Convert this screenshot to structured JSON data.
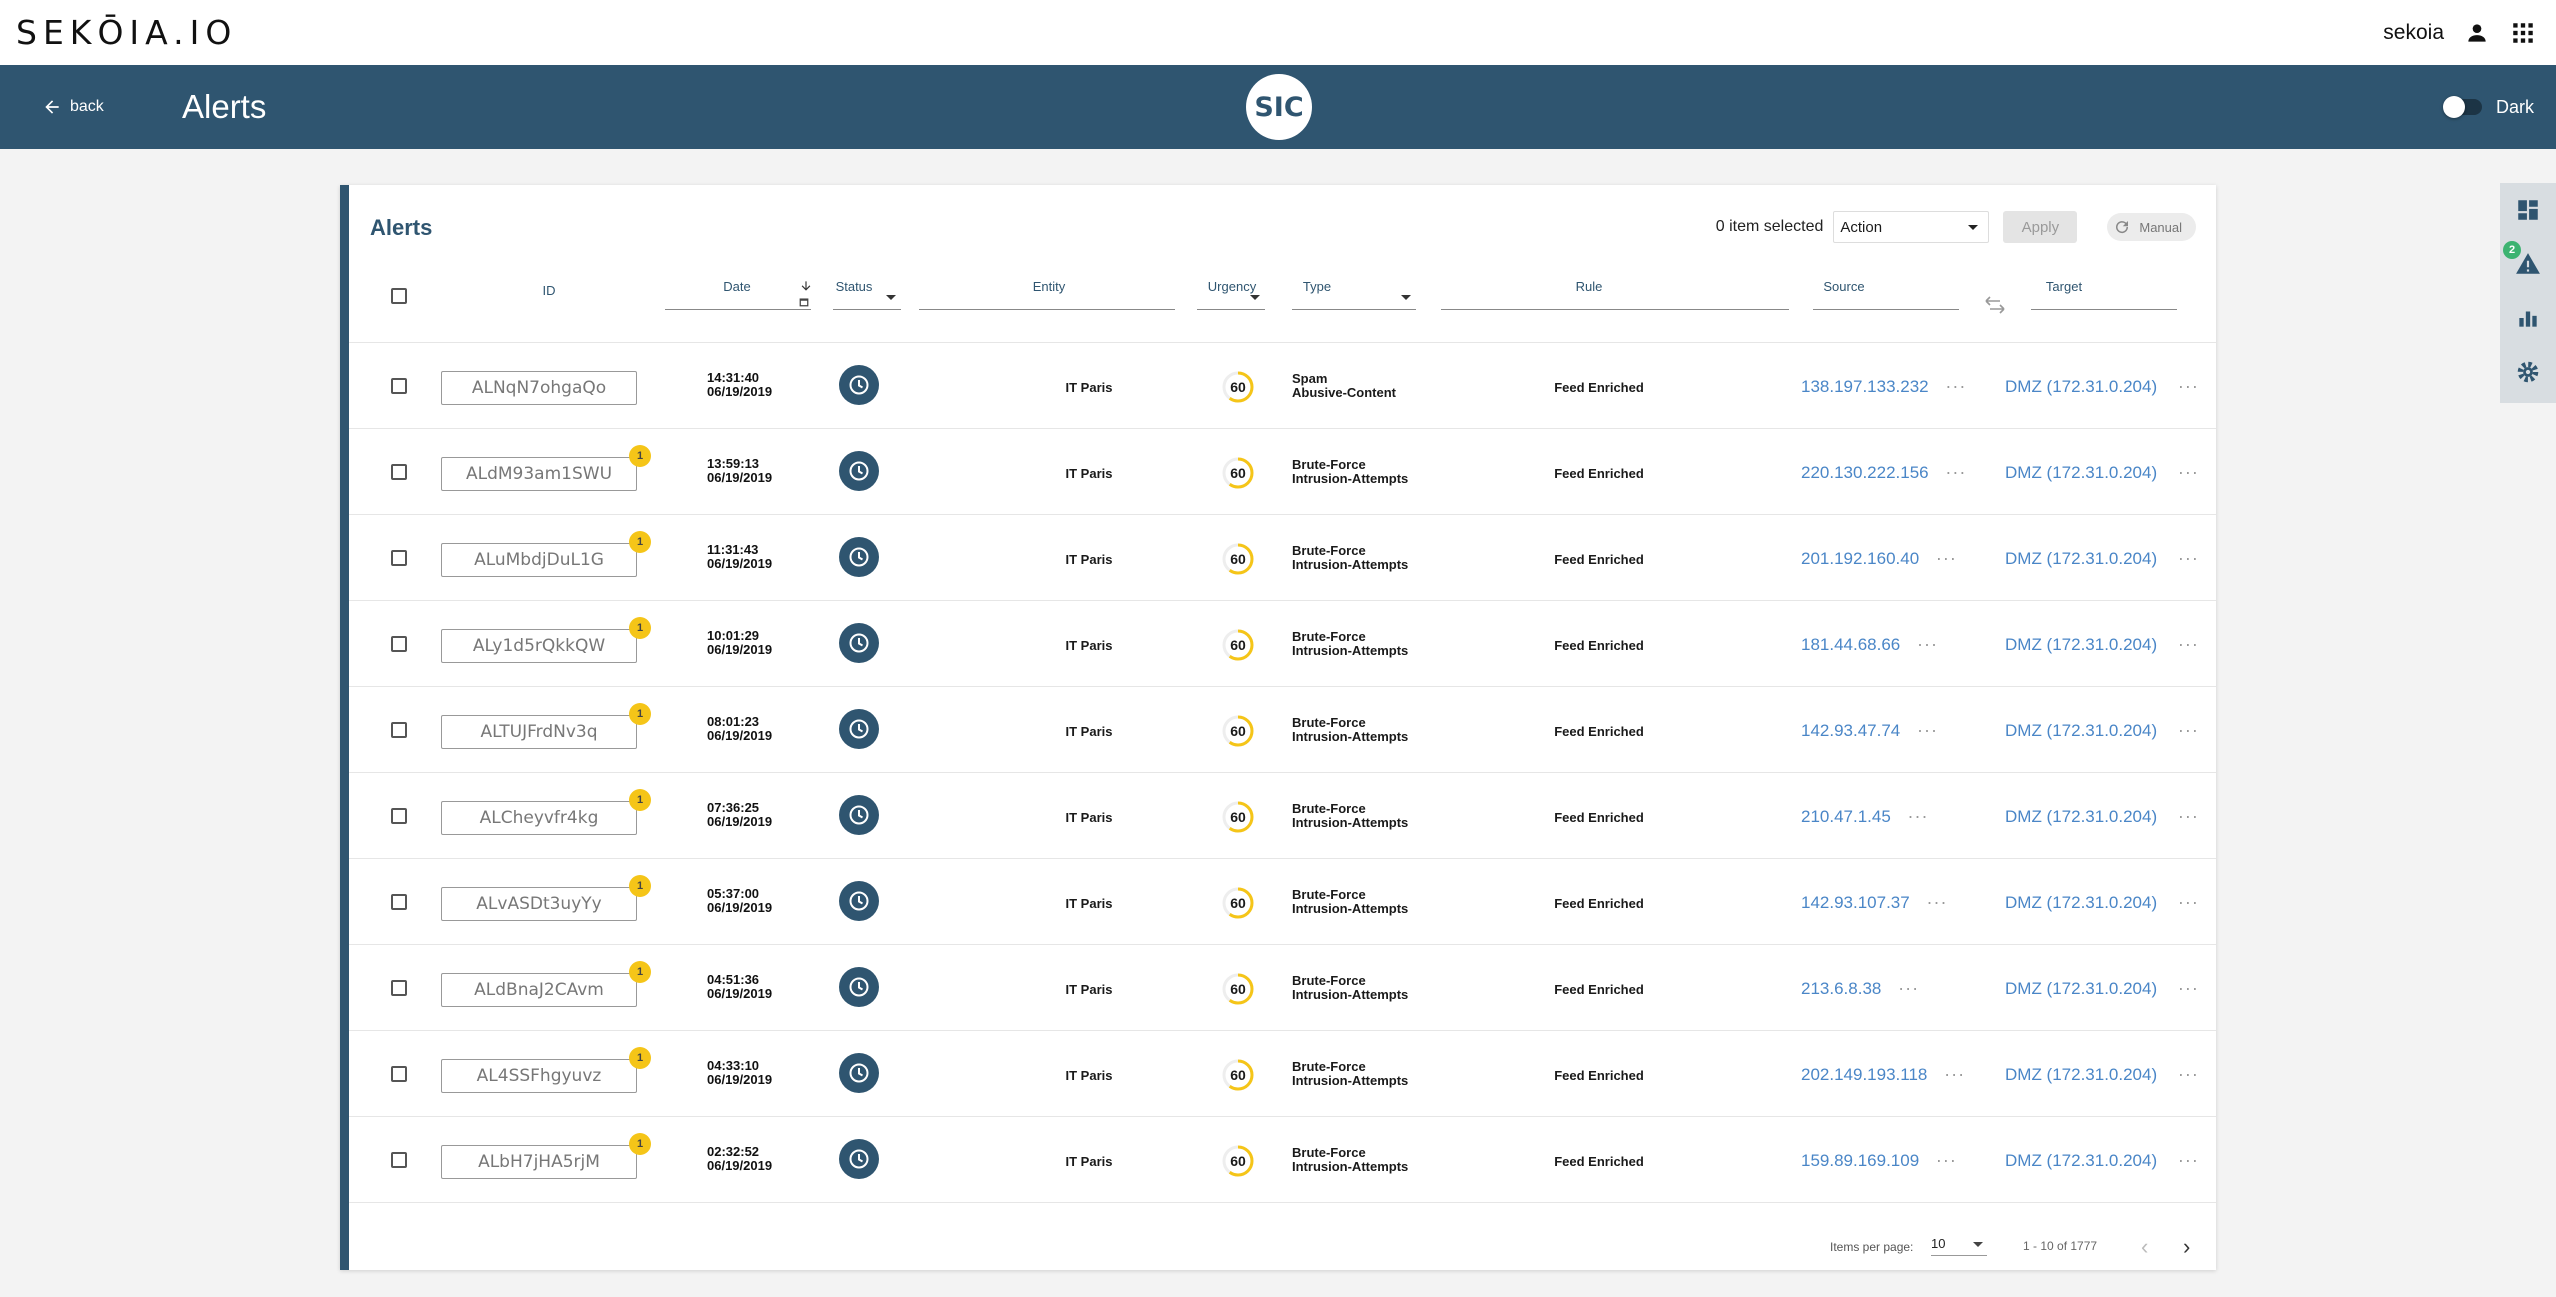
{
  "topbar": {
    "logo": "SEKŌIA.IO",
    "username": "sekoia"
  },
  "header": {
    "back_label": "back",
    "title": "Alerts",
    "center_logo": "SIC",
    "theme_toggle_label": "Dark"
  },
  "rail": {
    "items": [
      "dashboard-icon",
      "alert-icon",
      "bar-chart-icon",
      "gear-icon"
    ],
    "alert_badge": "2"
  },
  "card": {
    "title": "Alerts",
    "selected_count": "0 item selected",
    "action_select": "Action",
    "apply_label": "Apply",
    "manual_label": "Manual"
  },
  "columns": {
    "id": "ID",
    "date": "Date",
    "status": "Status",
    "entity": "Entity",
    "urgency": "Urgency",
    "type": "Type",
    "rule": "Rule",
    "source": "Source",
    "target": "Target"
  },
  "rows": [
    {
      "id": "ALNqN7ohgaQo",
      "badge": "",
      "time": "14:31:40",
      "date": "06/19/2019",
      "entity": "IT Paris",
      "urgency": "60",
      "type1": "Spam",
      "type2": "Abusive-Content",
      "rule": "Feed Enriched",
      "source": "138.197.133.232",
      "target": "DMZ (172.31.0.204)"
    },
    {
      "id": "ALdM93am1SWU",
      "badge": "1",
      "time": "13:59:13",
      "date": "06/19/2019",
      "entity": "IT Paris",
      "urgency": "60",
      "type1": "Brute-Force",
      "type2": "Intrusion-Attempts",
      "rule": "Feed Enriched",
      "source": "220.130.222.156",
      "target": "DMZ (172.31.0.204)"
    },
    {
      "id": "ALuMbdjDuL1G",
      "badge": "1",
      "time": "11:31:43",
      "date": "06/19/2019",
      "entity": "IT Paris",
      "urgency": "60",
      "type1": "Brute-Force",
      "type2": "Intrusion-Attempts",
      "rule": "Feed Enriched",
      "source": "201.192.160.40",
      "target": "DMZ (172.31.0.204)"
    },
    {
      "id": "ALy1d5rQkkQW",
      "badge": "1",
      "time": "10:01:29",
      "date": "06/19/2019",
      "entity": "IT Paris",
      "urgency": "60",
      "type1": "Brute-Force",
      "type2": "Intrusion-Attempts",
      "rule": "Feed Enriched",
      "source": "181.44.68.66",
      "target": "DMZ (172.31.0.204)"
    },
    {
      "id": "ALTUJFrdNv3q",
      "badge": "1",
      "time": "08:01:23",
      "date": "06/19/2019",
      "entity": "IT Paris",
      "urgency": "60",
      "type1": "Brute-Force",
      "type2": "Intrusion-Attempts",
      "rule": "Feed Enriched",
      "source": "142.93.47.74",
      "target": "DMZ (172.31.0.204)"
    },
    {
      "id": "ALCheyvfr4kg",
      "badge": "1",
      "time": "07:36:25",
      "date": "06/19/2019",
      "entity": "IT Paris",
      "urgency": "60",
      "type1": "Brute-Force",
      "type2": "Intrusion-Attempts",
      "rule": "Feed Enriched",
      "source": "210.47.1.45",
      "target": "DMZ (172.31.0.204)"
    },
    {
      "id": "ALvASDt3uyYy",
      "badge": "1",
      "time": "05:37:00",
      "date": "06/19/2019",
      "entity": "IT Paris",
      "urgency": "60",
      "type1": "Brute-Force",
      "type2": "Intrusion-Attempts",
      "rule": "Feed Enriched",
      "source": "142.93.107.37",
      "target": "DMZ (172.31.0.204)"
    },
    {
      "id": "ALdBnaJ2CAvm",
      "badge": "1",
      "time": "04:51:36",
      "date": "06/19/2019",
      "entity": "IT Paris",
      "urgency": "60",
      "type1": "Brute-Force",
      "type2": "Intrusion-Attempts",
      "rule": "Feed Enriched",
      "source": "213.6.8.38",
      "target": "DMZ (172.31.0.204)"
    },
    {
      "id": "AL4SSFhgyuvz",
      "badge": "1",
      "time": "04:33:10",
      "date": "06/19/2019",
      "entity": "IT Paris",
      "urgency": "60",
      "type1": "Brute-Force",
      "type2": "Intrusion-Attempts",
      "rule": "Feed Enriched",
      "source": "202.149.193.118",
      "target": "DMZ (172.31.0.204)"
    },
    {
      "id": "ALbH7jHA5rjM",
      "badge": "1",
      "time": "02:32:52",
      "date": "06/19/2019",
      "entity": "IT Paris",
      "urgency": "60",
      "type1": "Brute-Force",
      "type2": "Intrusion-Attempts",
      "rule": "Feed Enriched",
      "source": "159.89.169.109",
      "target": "DMZ (172.31.0.204)"
    }
  ],
  "footer": {
    "items_per_page_label": "Items per page:",
    "items_per_page": "10",
    "range": "1 - 10 of 1777"
  },
  "colors": {
    "brand": "#2f5570",
    "link": "#4a86c7",
    "badge": "#f5c518",
    "urgency_ring": "#f5c518"
  }
}
